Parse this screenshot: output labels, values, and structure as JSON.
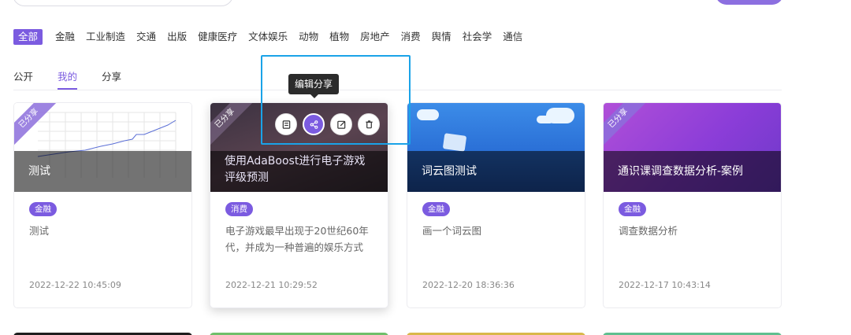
{
  "categories": [
    "全部",
    "金融",
    "工业制造",
    "交通",
    "出版",
    "健康医疗",
    "文体娱乐",
    "动物",
    "植物",
    "房地产",
    "消费",
    "舆情",
    "社会学",
    "通信"
  ],
  "tabs": [
    "公开",
    "我的",
    "分享"
  ],
  "tooltip": "编辑分享",
  "cards": [
    {
      "title": "测试",
      "ribbon": "已分享",
      "tag": "金融",
      "desc": "测试",
      "date": "2022-12-22 10:45:09"
    },
    {
      "title": "使用AdaBoost进行电子游戏评级预测",
      "ribbon": "已分享",
      "tag": "消费",
      "desc": "电子游戏最早出现于20世纪60年代，并成为一种普遍的娱乐方式",
      "date": "2022-12-21 10:29:52"
    },
    {
      "title": "词云图测试",
      "ribbon": "",
      "tag": "金融",
      "desc": "画一个词云图",
      "date": "2022-12-20 18:36:36"
    },
    {
      "title": "通识课调查数据分析-案例",
      "ribbon": "已分享",
      "tag": "金融",
      "desc": "调查数据分析",
      "date": "2022-12-17 10:43:14"
    }
  ],
  "action_icons": [
    "download-icon",
    "share-icon",
    "edit-icon",
    "delete-icon"
  ],
  "colors": {
    "accent": "#7b5be0",
    "highlight": "#1aa3e8"
  }
}
